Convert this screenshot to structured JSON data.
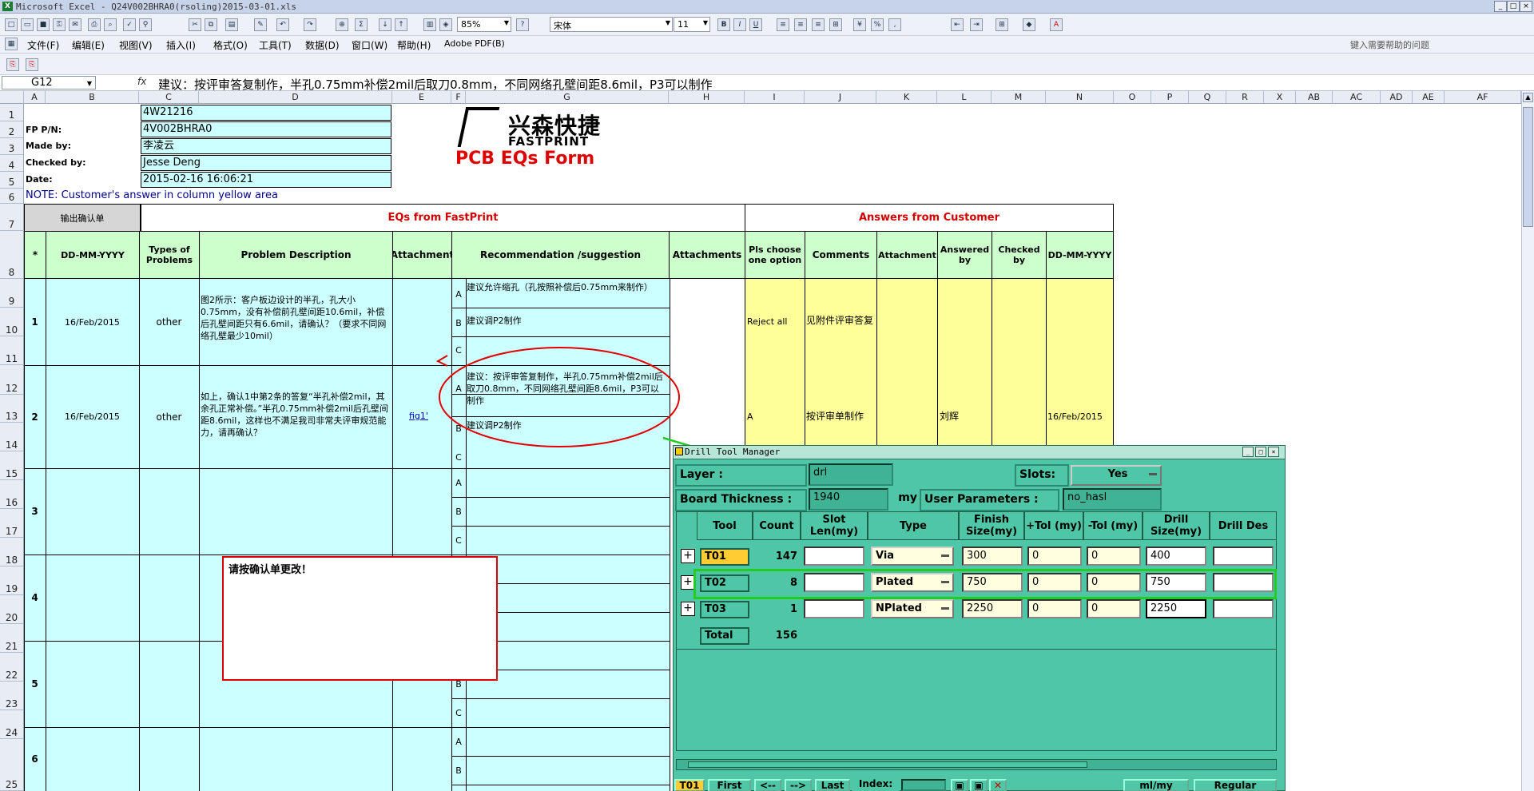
{
  "window": {
    "title": "Microsoft Excel - Q24V002BHRA0(rsoling)2015-03-01.xls"
  },
  "toolbar": {
    "zoom": "85%",
    "font": "宋体",
    "size": "11"
  },
  "menu": {
    "items": [
      "文件(F)",
      "编辑(E)",
      "视图(V)",
      "插入(I)",
      "格式(O)",
      "工具(T)",
      "数据(D)",
      "窗口(W)",
      "帮助(H)",
      "Adobe PDF(B)"
    ],
    "help_placeholder": "键入需要帮助的问题"
  },
  "formula_bar": {
    "cell_ref": "G12",
    "fx": "fx",
    "content": "建议：按评审答复制作，半孔0.75mm补偿2mil后取刀0.8mm，不同网络孔壁间距8.6mil，P3可以制作"
  },
  "columns": [
    "A",
    "B",
    "C",
    "D",
    "E",
    "F",
    "G",
    "H",
    "I",
    "J",
    "K",
    "L",
    "M",
    "N",
    "O",
    "P",
    "Q",
    "R",
    "X",
    "AB",
    "AC",
    "AD",
    "AE",
    "AF"
  ],
  "rows": [
    "1",
    "2",
    "3",
    "4",
    "5",
    "6",
    "7",
    "8",
    "9",
    "10",
    "11",
    "12",
    "13",
    "14",
    "15",
    "16",
    "17",
    "18",
    "19",
    "20",
    "21",
    "22",
    "23",
    "24",
    "25"
  ],
  "info": {
    "fp_label": "FP P/N:",
    "made_label": "Made by:",
    "checked_label": "Checked by:",
    "date_label": "Date:",
    "r1": "4W21216",
    "fp": "4V002BHRA0",
    "made": "李凌云",
    "checked": "Jesse Deng",
    "date": "2015-02-16 16:06:21",
    "note": "NOTE: Customer's  answer in column yellow area"
  },
  "logo": {
    "cn": "兴森快捷",
    "en": "FASTPRINT",
    "form_title": "PCB EQs Form"
  },
  "button_confirm": "输出确认单",
  "section_fp": "EQs from FastPrint",
  "section_customer": "Answers from Customer",
  "headers": {
    "star": "*",
    "date": "DD-MM-YYYY",
    "types": "Types of Problems",
    "problem": "Problem Description",
    "attachment": "Attachment",
    "recommendation": "Recommendation /suggestion",
    "attachments": "Attachments",
    "option": "Pls choose one option",
    "comments": "Comments",
    "attachment2": "Attachment",
    "answered": "Answered by",
    "checked": "Checked by",
    "date2": "DD-MM-YYYY"
  },
  "eq1": {
    "num": "1",
    "date": "16/Feb/2015",
    "type": "other",
    "desc": "图2所示：客户板边设计的半孔，孔大小0.75mm，没有补偿前孔壁间距10.6mil，补偿后孔壁间距只有6.6mil，请确认？（要求不同网络孔壁最少10mil）",
    "optA": "建议允许缩孔（孔按照补偿后0.75mm来制作）",
    "optB": "建议调P2制作",
    "answer": "Reject all",
    "comment": "见附件评审答复"
  },
  "eq2": {
    "num": "2",
    "date": "16/Feb/2015",
    "type": "other",
    "desc": "如上，确认1中第2条的答复“半孔补偿2mil，其余孔正常补偿。”半孔0.75mm补偿2mil后孔壁间距8.6mil，这样也不满足我司非常夫评审规范能力，请再确认？",
    "attach": "fig1'",
    "optA": "建议：按评审答复制作，半孔0.75mm补偿2mil后取刀0.8mm，不同网络孔壁间距8.6mil，P3可以制作",
    "optB": "建议调P2制作",
    "answer": "A",
    "comment": "按评审单制作",
    "answered_by": "刘辉",
    "date2": "16/Feb/2015"
  },
  "row_nums": {
    "r3": "3",
    "r4": "4",
    "r5": "5",
    "r6": "6"
  },
  "letters": {
    "a": "A",
    "b": "B",
    "c": "C"
  },
  "callout": "请按确认单更改！",
  "drill": {
    "title": "Drill Tool Manager",
    "layer_label": "Layer            :",
    "layer_value": "drl",
    "slots_label": "Slots:",
    "slots_value": "Yes",
    "thickness_label": "Board Thickness :",
    "thickness_value": "1940",
    "thickness_unit": "my",
    "user_params_label": "User Parameters :",
    "user_params_value": "no_hasl",
    "col_tool": "Tool",
    "col_count": "Count",
    "col_slot": "Slot Len(my)",
    "col_type": "Type",
    "col_finish": "Finish Size(my)",
    "col_ptol": "+Tol (my)",
    "col_mtol": "-Tol (my)",
    "col_drill": "Drill Size(my)",
    "col_des": "Drill Des",
    "rows": [
      {
        "tool": "T01",
        "count": "147",
        "type": "Via",
        "finish": "300",
        "ptol": "0",
        "mtol": "0",
        "drill": "400"
      },
      {
        "tool": "T02",
        "count": "8",
        "type": "Plated",
        "finish": "750",
        "ptol": "0",
        "mtol": "0",
        "drill": "750"
      },
      {
        "tool": "T03",
        "count": "1",
        "type": "NPlated",
        "finish": "2250",
        "ptol": "0",
        "mtol": "0",
        "drill": "2250"
      }
    ],
    "total_label": "Total",
    "total_count": "156",
    "bottom": {
      "cur": "T01",
      "first": "First",
      "prev": "<--",
      "next": "-->",
      "last": "Last",
      "index": "Index:",
      "units": "ml/my",
      "mode": "Regular"
    }
  }
}
